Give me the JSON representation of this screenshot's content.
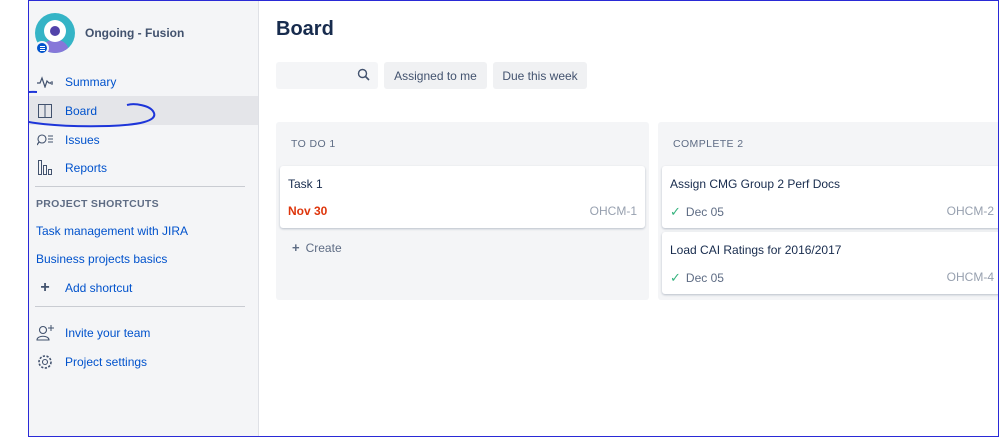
{
  "project": {
    "name": "Ongoing - Fusion"
  },
  "nav": {
    "summary": "Summary",
    "board": "Board",
    "issues": "Issues",
    "reports": "Reports"
  },
  "shortcuts": {
    "heading": "PROJECT SHORTCUTS",
    "items": [
      "Task management with JIRA",
      "Business projects basics"
    ],
    "add": "Add shortcut"
  },
  "footer_nav": {
    "invite": "Invite your team",
    "settings": "Project settings"
  },
  "board": {
    "title": "Board",
    "search": {
      "placeholder": ""
    },
    "filters": [
      "Assigned to me",
      "Due this week"
    ],
    "columns": [
      {
        "title": "TO DO 1",
        "cards": [
          {
            "title": "Task 1",
            "due": "Nov 30",
            "key": "OHCM-1"
          }
        ],
        "create_label": "Create"
      },
      {
        "title": "COMPLETE 2",
        "cards": [
          {
            "title": "Assign CMG Group 2 Perf Docs",
            "due": "Dec 05",
            "key": "OHCM-2"
          },
          {
            "title": "Load CAI Ratings for 2016/2017",
            "due": "Dec 05",
            "key": "OHCM-4"
          }
        ]
      }
    ]
  },
  "icons": {
    "summary": "pulse-icon",
    "board": "board-columns-icon",
    "issues": "issues-search-icon",
    "reports": "bar-chart-icon",
    "add": "plus-icon",
    "invite": "add-person-icon",
    "settings": "gear-icon",
    "search": "search-icon",
    "done": "check-icon"
  },
  "colors": {
    "link": "#0052cc",
    "overdue": "#de350b",
    "done_check": "#36b37e",
    "annotation": "#1d35d9"
  }
}
